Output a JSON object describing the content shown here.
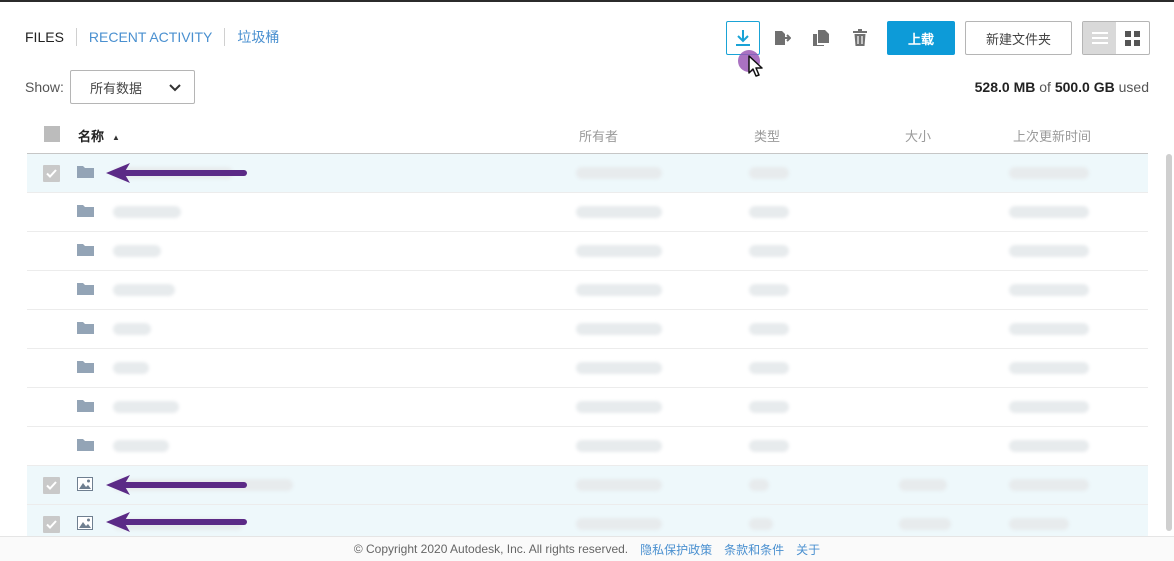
{
  "tabs": [
    "FILES",
    "RECENT ACTIVITY",
    "垃圾桶"
  ],
  "toolbar": {
    "download_icon": "download-icon",
    "move_icon": "move-icon",
    "copy_icon": "copy-icon",
    "delete_icon": "trash-icon",
    "upload_label": "上载",
    "new_folder_label": "新建文件夹",
    "list_view_icon": "list-view-icon",
    "grid_view_icon": "grid-view-icon"
  },
  "filter": {
    "show_label": "Show:",
    "selected": "所有数据"
  },
  "usage": {
    "used": "528.0 MB",
    "of": "of",
    "total": "500.0 GB",
    "suffix": "used"
  },
  "table": {
    "columns": {
      "name": "名称",
      "owner": "所有者",
      "type": "类型",
      "size": "大小",
      "modified": "上次更新时间"
    }
  },
  "footer": {
    "copyright": "© Copyright 2020 Autodesk, Inc. All rights reserved.",
    "privacy": "隐私保护政策",
    "terms": "条款和条件",
    "about": "关于"
  },
  "colors": {
    "accent": "#0d9bd8",
    "arrow": "#5b2a86",
    "selected_row": "#eef8fb"
  }
}
